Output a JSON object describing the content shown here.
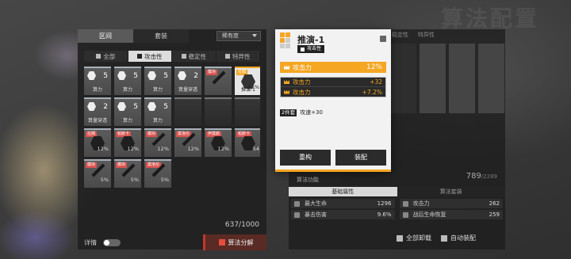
{
  "background": {
    "watermark_text": "算法配置"
  },
  "left_panel": {
    "top_tabs": [
      "区间",
      "套装"
    ],
    "sort_label": "稀有度",
    "filter_tabs": [
      "全部",
      "攻击性",
      "稳定性",
      "特异性"
    ],
    "cards": [
      {
        "num": "5",
        "sub": "算力"
      },
      {
        "num": "5",
        "sub": "算力"
      },
      {
        "num": "5",
        "sub": "算力"
      },
      {
        "num": "2",
        "sub": "算量穿透"
      },
      {
        "tag": "模块",
        "pct": "",
        "type": "sword"
      },
      {
        "tag": "拉姆",
        "pct": "12%",
        "sub": "推演-1",
        "type": "hex",
        "selected": true
      },
      {
        "num": "2",
        "sub": "算量穿透"
      },
      {
        "num": "5",
        "sub": "算力"
      },
      {
        "num": "5",
        "sub": "算力"
      },
      {
        "type": "empty"
      },
      {
        "type": "empty"
      },
      {
        "type": "empty"
      },
      {
        "tag": "拉姆",
        "pct": "12%",
        "type": "hex"
      },
      {
        "tag": "帕斯卡",
        "pct": "12%",
        "type": "hex"
      },
      {
        "tag": "模块",
        "pct": "12%",
        "type": "sword"
      },
      {
        "tag": "莫洛伦",
        "pct": "12%",
        "type": "sword"
      },
      {
        "tag": "伊莫斯",
        "pct": "12%",
        "type": "hex"
      },
      {
        "tag": "帕斯卡",
        "pct": "54",
        "type": "hex"
      },
      {
        "tag": "模块",
        "pct": "5%",
        "type": "sword"
      },
      {
        "tag": "模块",
        "pct": "5%",
        "type": "sword"
      },
      {
        "tag": "莫洛伦",
        "pct": "5%",
        "type": "sword"
      }
    ],
    "count": "637/1000",
    "detail_label": "详情",
    "decompose_label": "算法分解"
  },
  "popup": {
    "title": "推演-1",
    "type_badge": "攻击性",
    "main_stat": {
      "name": "攻击力",
      "value": "12%"
    },
    "sub_stats": [
      {
        "name": "攻击力",
        "value": "+32"
      },
      {
        "name": "攻击力",
        "value": "+7.2%"
      }
    ],
    "set_tag": "2件套",
    "set_effect": "攻速+30",
    "buttons": [
      "重构",
      "装配"
    ]
  },
  "right_panel": {
    "tabs": [
      "稳定性",
      "特异性"
    ],
    "total": "789",
    "total_max": "/2289",
    "algo_label": "算法功能",
    "algo_tabs": [
      "基础属性",
      "算法套装"
    ],
    "stats": [
      {
        "name": "最大生命",
        "value": "1296"
      },
      {
        "name": "攻击力",
        "value": "262"
      },
      {
        "name": "暴击伤害",
        "value": "9.6%"
      },
      {
        "name": "战后生命恢复",
        "value": "259"
      }
    ],
    "bottom_buttons": [
      "全部卸载",
      "自动装配"
    ]
  },
  "colors": {
    "accent": "#f5a623",
    "danger": "#c0392b"
  }
}
